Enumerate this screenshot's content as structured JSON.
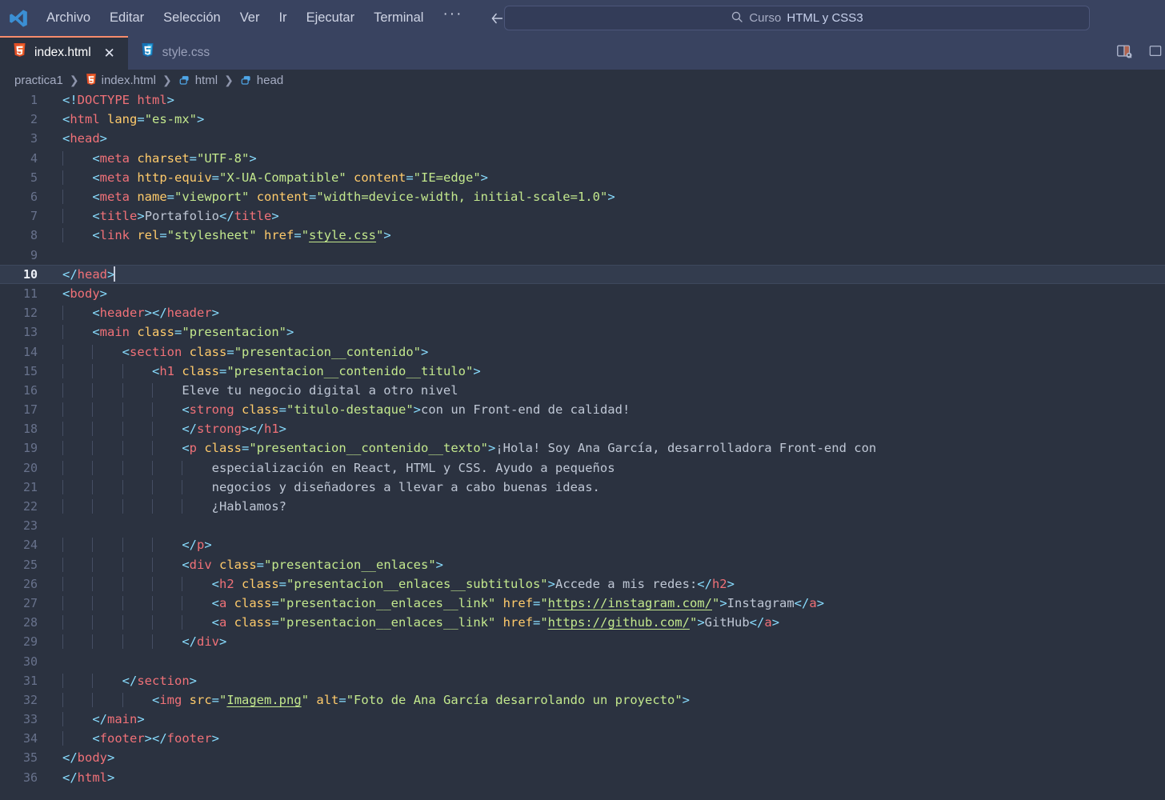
{
  "titlebar": {
    "logo_icon": "vscode-logo-icon",
    "menu": [
      {
        "label": "Archivo",
        "name": "menu-archivo"
      },
      {
        "label": "Editar",
        "name": "menu-editar"
      },
      {
        "label": "Selección",
        "name": "menu-seleccion"
      },
      {
        "label": "Ver",
        "name": "menu-ver"
      },
      {
        "label": "Ir",
        "name": "menu-ir"
      },
      {
        "label": "Ejecutar",
        "name": "menu-ejecutar"
      },
      {
        "label": "Terminal",
        "name": "menu-terminal"
      }
    ],
    "more_label": "···",
    "back_icon": "arrow-left-icon",
    "forward_icon": "arrow-right-icon",
    "search": {
      "icon": "search-icon",
      "prefix": "Curso ",
      "highlight": "HTML y CSS3",
      "full_text": "Curso HTML y CSS3"
    },
    "layout_icon": "editor-layout-icon"
  },
  "tabs": [
    {
      "label": "index.html",
      "icon": "html5-file-icon",
      "active": true,
      "close_label": "✕"
    },
    {
      "label": "style.css",
      "icon": "css3-file-icon",
      "active": false
    }
  ],
  "breadcrumb": [
    {
      "label": "practica1",
      "icon": null
    },
    {
      "label": "index.html",
      "icon": "html5-file-icon"
    },
    {
      "label": "html",
      "icon": "symbol-field-icon"
    },
    {
      "label": "head",
      "icon": "symbol-field-icon"
    }
  ],
  "breadcrumb_separator": "❯",
  "editor": {
    "active_line": 10,
    "total_lines": 36,
    "colors": {
      "background": "#2b3240",
      "active_line": "#333c4e",
      "tag": "#f07178",
      "attribute": "#ffcb6b",
      "string": "#c3e88d",
      "punctuation": "#89ddff",
      "text": "#bfc7d5",
      "line_number": "#68728c",
      "titlebar": "#394360"
    },
    "lines": [
      {
        "n": 1,
        "indent": 0,
        "html": "<span class=\"pnc\">&lt;!</span><span class=\"dt\">DOCTYPE</span> <span class=\"dt\">html</span><span class=\"pnc\">&gt;</span>"
      },
      {
        "n": 2,
        "indent": 0,
        "html": "<span class=\"pnc\">&lt;</span><span class=\"tag\">html</span> <span class=\"att\">lang</span><span class=\"pnc\">=</span><span class=\"str\">\"es-mx\"</span><span class=\"pnc\">&gt;</span>"
      },
      {
        "n": 3,
        "indent": 0,
        "html": "<span class=\"pnc\">&lt;</span><span class=\"tag\">head</span><span class=\"pnc\">&gt;</span>"
      },
      {
        "n": 4,
        "indent": 1,
        "html": "    <span class=\"pnc\">&lt;</span><span class=\"tag\">meta</span> <span class=\"att\">charset</span><span class=\"pnc\">=</span><span class=\"str\">\"UTF-8\"</span><span class=\"pnc\">&gt;</span>"
      },
      {
        "n": 5,
        "indent": 1,
        "html": "    <span class=\"pnc\">&lt;</span><span class=\"tag\">meta</span> <span class=\"att\">http-equiv</span><span class=\"pnc\">=</span><span class=\"str\">\"X-UA-Compatible\"</span> <span class=\"att\">content</span><span class=\"pnc\">=</span><span class=\"str\">\"IE=edge\"</span><span class=\"pnc\">&gt;</span>"
      },
      {
        "n": 6,
        "indent": 1,
        "html": "    <span class=\"pnc\">&lt;</span><span class=\"tag\">meta</span> <span class=\"att\">name</span><span class=\"pnc\">=</span><span class=\"str\">\"viewport\"</span> <span class=\"att\">content</span><span class=\"pnc\">=</span><span class=\"str\">\"width=device-width, initial-scale=1.0\"</span><span class=\"pnc\">&gt;</span>"
      },
      {
        "n": 7,
        "indent": 1,
        "html": "    <span class=\"pnc\">&lt;</span><span class=\"tag\">title</span><span class=\"pnc\">&gt;</span><span class=\"txt\">Portafolio</span><span class=\"pnc\">&lt;/</span><span class=\"tag\">title</span><span class=\"pnc\">&gt;</span>"
      },
      {
        "n": 8,
        "indent": 1,
        "html": "    <span class=\"pnc\">&lt;</span><span class=\"tag\">link</span> <span class=\"att\">rel</span><span class=\"pnc\">=</span><span class=\"str\">\"stylesheet\"</span> <span class=\"att\">href</span><span class=\"pnc\">=</span><span class=\"str\">\"</span><span class=\"lnk\">style.css</span><span class=\"str\">\"</span><span class=\"pnc\">&gt;</span>"
      },
      {
        "n": 9,
        "indent": 1,
        "html": ""
      },
      {
        "n": 10,
        "indent": 0,
        "active": true,
        "html": "<span class=\"pnc\">&lt;/</span><span class=\"tag\">head</span><span class=\"pnc\">&gt;</span><span class=\"cursor\"></span>"
      },
      {
        "n": 11,
        "indent": 0,
        "html": "<span class=\"pnc\">&lt;</span><span class=\"tag\">body</span><span class=\"pnc\">&gt;</span>"
      },
      {
        "n": 12,
        "indent": 1,
        "html": "    <span class=\"pnc\">&lt;</span><span class=\"tag\">header</span><span class=\"pnc\">&gt;&lt;/</span><span class=\"tag\">header</span><span class=\"pnc\">&gt;</span>"
      },
      {
        "n": 13,
        "indent": 1,
        "html": "    <span class=\"pnc\">&lt;</span><span class=\"tag\">main</span> <span class=\"att\">class</span><span class=\"pnc\">=</span><span class=\"str\">\"presentacion\"</span><span class=\"pnc\">&gt;</span>"
      },
      {
        "n": 14,
        "indent": 2,
        "html": "        <span class=\"pnc\">&lt;</span><span class=\"tag\">section</span> <span class=\"att\">class</span><span class=\"pnc\">=</span><span class=\"str\">\"presentacion__contenido\"</span><span class=\"pnc\">&gt;</span>"
      },
      {
        "n": 15,
        "indent": 3,
        "html": "            <span class=\"pnc\">&lt;</span><span class=\"tag\">h1</span> <span class=\"att\">class</span><span class=\"pnc\">=</span><span class=\"str\">\"presentacion__contenido__titulo\"</span><span class=\"pnc\">&gt;</span>"
      },
      {
        "n": 16,
        "indent": 4,
        "html": "                <span class=\"txt\">Eleve tu negocio digital a otro nivel</span>"
      },
      {
        "n": 17,
        "indent": 4,
        "html": "                <span class=\"pnc\">&lt;</span><span class=\"tag\">strong</span> <span class=\"att\">class</span><span class=\"pnc\">=</span><span class=\"str\">\"titulo-destaque\"</span><span class=\"pnc\">&gt;</span><span class=\"txt\">con un Front-end de calidad!</span>"
      },
      {
        "n": 18,
        "indent": 4,
        "html": "                <span class=\"pnc\">&lt;/</span><span class=\"tag\">strong</span><span class=\"pnc\">&gt;&lt;/</span><span class=\"tag\">h1</span><span class=\"pnc\">&gt;</span>"
      },
      {
        "n": 19,
        "indent": 4,
        "html": "                <span class=\"pnc\">&lt;</span><span class=\"tag\">p</span> <span class=\"att\">class</span><span class=\"pnc\">=</span><span class=\"str\">\"presentacion__contenido__texto\"</span><span class=\"pnc\">&gt;</span><span class=\"txt\">¡Hola! Soy Ana García, desarrolladora Front-end con</span>"
      },
      {
        "n": 20,
        "indent": 5,
        "html": "                    <span class=\"txt\">especialización en React, HTML y CSS. Ayudo a pequeños</span>"
      },
      {
        "n": 21,
        "indent": 5,
        "html": "                    <span class=\"txt\">negocios y diseñadores a llevar a cabo buenas ideas.</span>"
      },
      {
        "n": 22,
        "indent": 5,
        "html": "                    <span class=\"txt\">¿Hablamos?</span>"
      },
      {
        "n": 23,
        "indent": 5,
        "html": ""
      },
      {
        "n": 24,
        "indent": 4,
        "html": "                <span class=\"pnc\">&lt;/</span><span class=\"tag\">p</span><span class=\"pnc\">&gt;</span>"
      },
      {
        "n": 25,
        "indent": 4,
        "html": "                <span class=\"pnc\">&lt;</span><span class=\"tag\">div</span> <span class=\"att\">class</span><span class=\"pnc\">=</span><span class=\"str\">\"presentacion__enlaces\"</span><span class=\"pnc\">&gt;</span>"
      },
      {
        "n": 26,
        "indent": 5,
        "html": "                    <span class=\"pnc\">&lt;</span><span class=\"tag\">h2</span> <span class=\"att\">class</span><span class=\"pnc\">=</span><span class=\"str\">\"presentacion__enlaces__subtitulos\"</span><span class=\"pnc\">&gt;</span><span class=\"txt\">Accede a mis redes:</span><span class=\"pnc\">&lt;/</span><span class=\"tag\">h2</span><span class=\"pnc\">&gt;</span>"
      },
      {
        "n": 27,
        "indent": 5,
        "html": "                    <span class=\"pnc\">&lt;</span><span class=\"tag\">a</span> <span class=\"att\">class</span><span class=\"pnc\">=</span><span class=\"str\">\"presentacion__enlaces__link\"</span> <span class=\"att\">href</span><span class=\"pnc\">=</span><span class=\"str\">\"</span><span class=\"lnk\">https://instagram.com/</span><span class=\"str\">\"</span><span class=\"pnc\">&gt;</span><span class=\"txt\">Instagram</span><span class=\"pnc\">&lt;/</span><span class=\"tag\">a</span><span class=\"pnc\">&gt;</span>"
      },
      {
        "n": 28,
        "indent": 5,
        "html": "                    <span class=\"pnc\">&lt;</span><span class=\"tag\">a</span> <span class=\"att\">class</span><span class=\"pnc\">=</span><span class=\"str\">\"presentacion__enlaces__link\"</span> <span class=\"att\">href</span><span class=\"pnc\">=</span><span class=\"str\">\"</span><span class=\"lnk\">https://github.com/</span><span class=\"str\">\"</span><span class=\"pnc\">&gt;</span><span class=\"txt\">GitHub</span><span class=\"pnc\">&lt;/</span><span class=\"tag\">a</span><span class=\"pnc\">&gt;</span>"
      },
      {
        "n": 29,
        "indent": 4,
        "html": "                <span class=\"pnc\">&lt;/</span><span class=\"tag\">div</span><span class=\"pnc\">&gt;</span>"
      },
      {
        "n": 30,
        "indent": 4,
        "html": ""
      },
      {
        "n": 31,
        "indent": 2,
        "html": "        <span class=\"pnc\">&lt;/</span><span class=\"tag\">section</span><span class=\"pnc\">&gt;</span>"
      },
      {
        "n": 32,
        "indent": 3,
        "html": "            <span class=\"pnc\">&lt;</span><span class=\"tag\">img</span> <span class=\"att\">src</span><span class=\"pnc\">=</span><span class=\"str\">\"</span><span class=\"lnk\">Imagem.png</span><span class=\"str\">\"</span> <span class=\"att\">alt</span><span class=\"pnc\">=</span><span class=\"str\">\"Foto de Ana García desarrolando un proyecto\"</span><span class=\"pnc\">&gt;</span>"
      },
      {
        "n": 33,
        "indent": 1,
        "html": "    <span class=\"pnc\">&lt;/</span><span class=\"tag\">main</span><span class=\"pnc\">&gt;</span>"
      },
      {
        "n": 34,
        "indent": 1,
        "html": "    <span class=\"pnc\">&lt;</span><span class=\"tag\">footer</span><span class=\"pnc\">&gt;&lt;/</span><span class=\"tag\">footer</span><span class=\"pnc\">&gt;</span>"
      },
      {
        "n": 35,
        "indent": 0,
        "html": "<span class=\"pnc\">&lt;/</span><span class=\"tag\">body</span><span class=\"pnc\">&gt;</span>"
      },
      {
        "n": 36,
        "indent": 0,
        "html": "<span class=\"pnc\">&lt;/</span><span class=\"tag\">html</span><span class=\"pnc\">&gt;</span>"
      }
    ]
  }
}
